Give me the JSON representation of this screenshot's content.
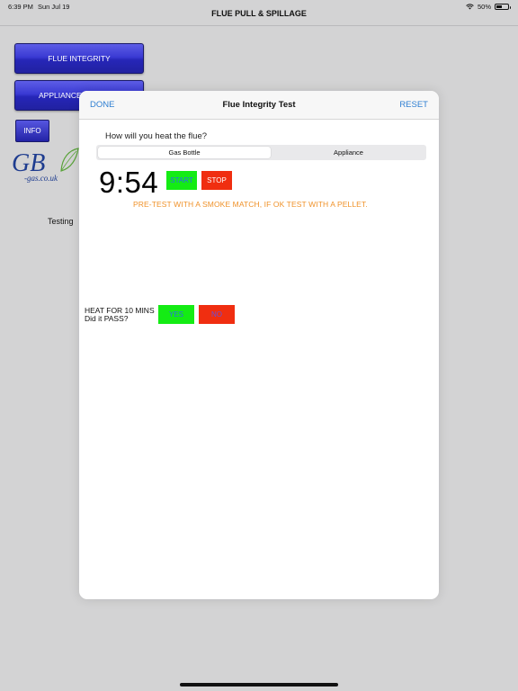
{
  "status": {
    "time": "6:39 PM",
    "date": "Sun Jul 19",
    "battery": "50%",
    "battery_level": 0.5
  },
  "nav": {
    "title": "FLUE PULL & SPILLAGE"
  },
  "background": {
    "buttons": {
      "flue_integrity": "FLUE INTEGRITY",
      "appliance": "APPLIANCE",
      "info": "INFO"
    },
    "logo": {
      "main": "GB",
      "sub": "-gas.co.uk"
    },
    "testing_text": "Testing"
  },
  "modal": {
    "done": "DONE",
    "title": "Flue Integrity Test",
    "reset": "RESET",
    "question": "How will you heat the flue?",
    "segments": [
      "Gas Bottle",
      "Appliance"
    ],
    "selected_segment": "Gas Bottle",
    "timer": "9:54",
    "start": "START",
    "stop": "STOP",
    "pretest": "PRE-TEST WITH A SMOKE MATCH, IF OK TEST WITH A PELLET.",
    "heat_line1": "HEAT FOR 10 MINS",
    "heat_line2": "Did it PASS?",
    "yes": "YES",
    "no": "NO"
  },
  "colors": {
    "accent_blue": "#2f7fd2",
    "green_button": "#14ec14",
    "red_button": "#f02e10",
    "orange_text": "#f0922a",
    "glass_blue": "#2626b8"
  }
}
